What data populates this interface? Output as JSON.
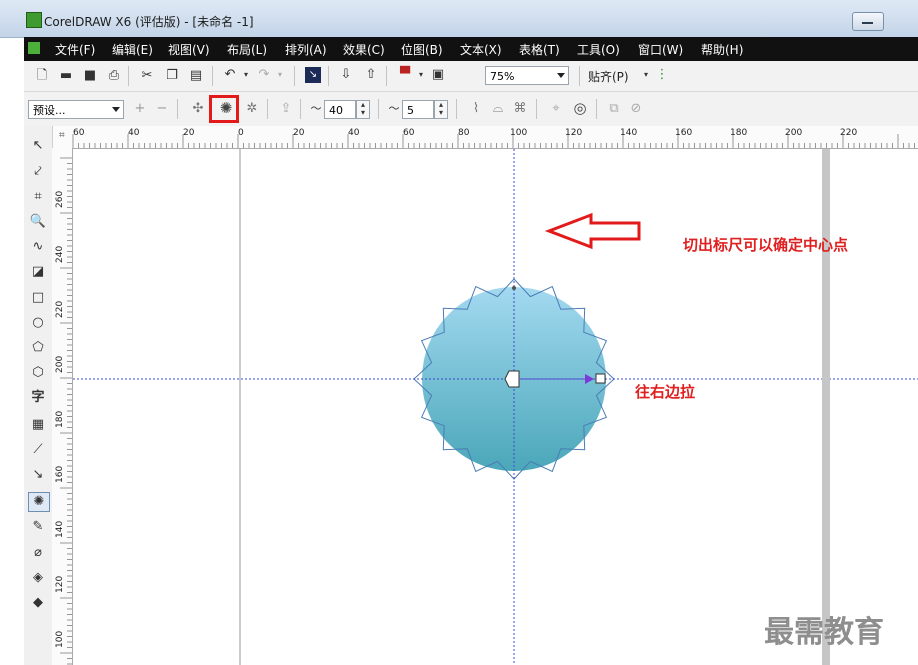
{
  "window": {
    "title": "CorelDRAW X6 (评估版) - [未命名 -1]"
  },
  "menu": [
    {
      "label": "文件(F)"
    },
    {
      "label": "编辑(E)"
    },
    {
      "label": "视图(V)"
    },
    {
      "label": "布局(L)"
    },
    {
      "label": "排列(A)"
    },
    {
      "label": "效果(C)"
    },
    {
      "label": "位图(B)"
    },
    {
      "label": "文本(X)"
    },
    {
      "label": "表格(T)"
    },
    {
      "label": "工具(O)"
    },
    {
      "label": "窗口(W)"
    },
    {
      "label": "帮助(H)"
    }
  ],
  "toolbar": {
    "zoom_value": "75%",
    "snap_label": "贴齐(P)"
  },
  "property_bar": {
    "preset_value": "预设...",
    "points_value": "40",
    "depth_value": "5"
  },
  "rulers": {
    "horizontal": [
      "60",
      "40",
      "20",
      "0",
      "20",
      "40",
      "60",
      "80",
      "100",
      "120",
      "140",
      "160",
      "180",
      "200",
      "220"
    ],
    "vertical": [
      "260",
      "240",
      "220",
      "200",
      "180",
      "160",
      "140",
      "120",
      "100"
    ]
  },
  "annotations": {
    "ruler_note": "切出标尺可以确定中心点",
    "drag_note": "往右边拉"
  },
  "watermark": "最需教育",
  "colors": {
    "menubar": "#111111",
    "annotation": "#e02020",
    "circle_top": "#a3d9f0",
    "circle_bottom": "#4aa7b9",
    "guide": "#3b48d6"
  }
}
